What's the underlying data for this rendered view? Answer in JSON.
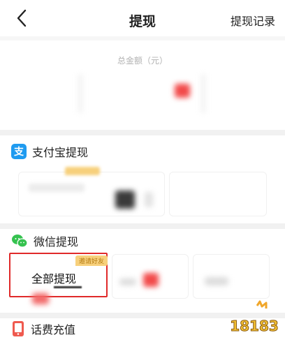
{
  "header": {
    "back_label": "<",
    "title": "提现",
    "records_label": "提现记录"
  },
  "total": {
    "label": "总金额（元）"
  },
  "alipay": {
    "section_title": "支付宝提现",
    "icon": "alipay-icon",
    "icon_glyph": "支"
  },
  "wechat": {
    "section_title": "微信提现",
    "icon": "wechat-icon",
    "option_all_label": "全部提现",
    "option_all_badge": "邀请好友"
  },
  "recharge": {
    "section_title": "话费充值",
    "icon": "phone-icon"
  },
  "watermark": {
    "text": "18183"
  },
  "colors": {
    "accent_red": "#e02a2a",
    "alipay_blue": "#1f9bf0",
    "wechat_green": "#35c24f",
    "phone_red": "#ef5a4f",
    "badge_gold": "#f7d07c"
  }
}
